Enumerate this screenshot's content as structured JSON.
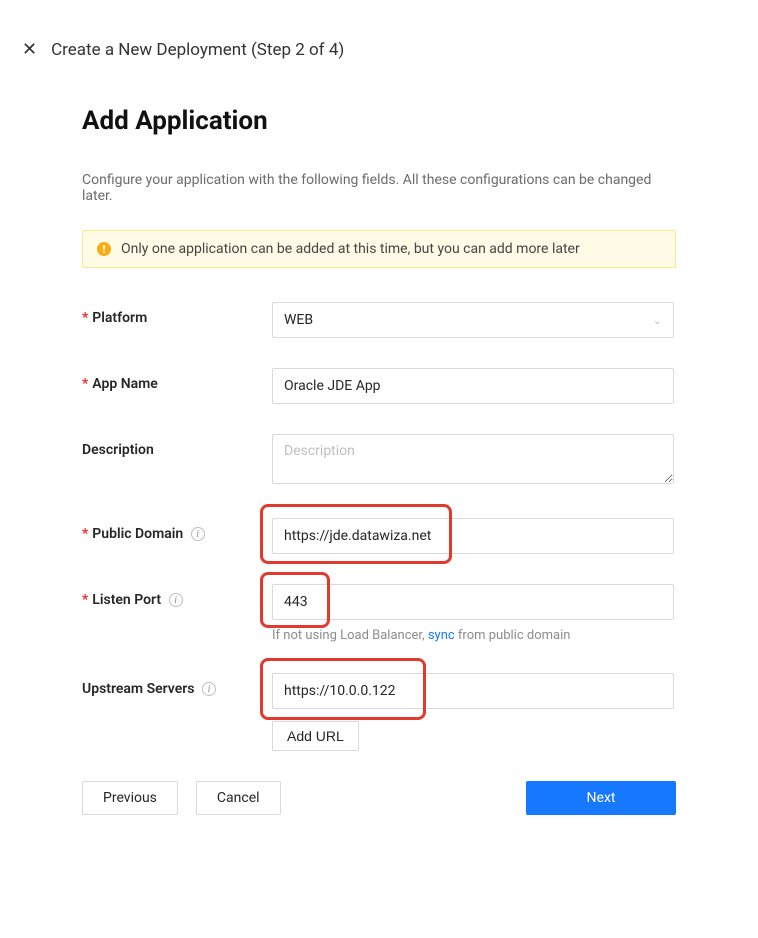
{
  "header": {
    "step_text": "Create a New Deployment (Step 2 of 4)"
  },
  "page": {
    "title": "Add Application",
    "subtitle": "Configure your application with the following fields. All these configurations can be changed later."
  },
  "warning": {
    "text": "Only one application can be added at this time, but you can add more later"
  },
  "form": {
    "platform": {
      "label": "Platform",
      "value": "WEB"
    },
    "app_name": {
      "label": "App Name",
      "value": "Oracle JDE App"
    },
    "description": {
      "label": "Description",
      "placeholder": "Description",
      "value": ""
    },
    "public_domain": {
      "label": "Public Domain",
      "value": "https://jde.datawiza.net"
    },
    "listen_port": {
      "label": "Listen Port",
      "value": "443",
      "hint_pre": "If not using Load Balancer, ",
      "hint_link": "sync",
      "hint_post": " from public domain"
    },
    "upstream": {
      "label": "Upstream Servers",
      "value": "https://10.0.0.122",
      "add_url": "Add URL"
    }
  },
  "buttons": {
    "previous": "Previous",
    "cancel": "Cancel",
    "next": "Next"
  }
}
